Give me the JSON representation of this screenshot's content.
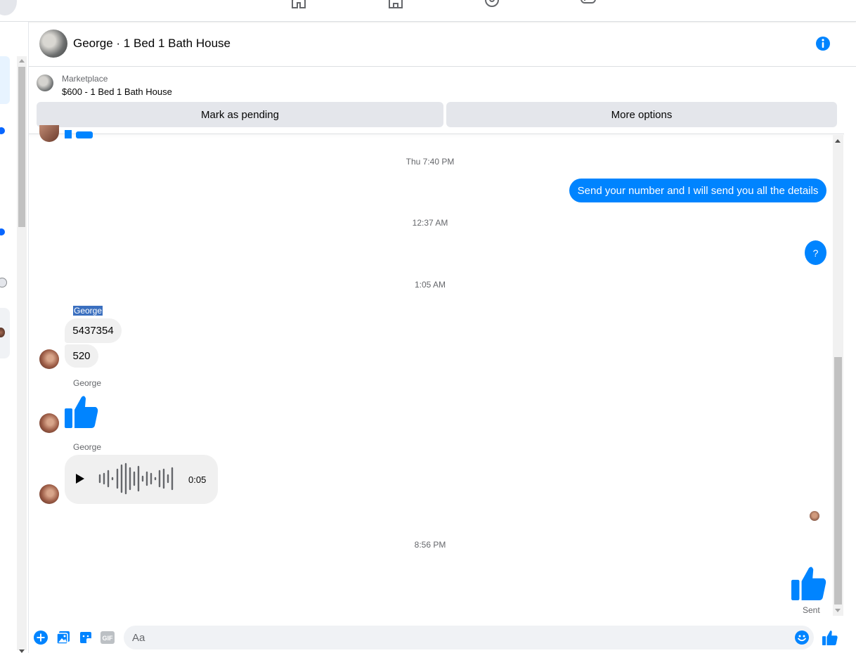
{
  "colors": {
    "accent": "#0084ff",
    "incoming_bubble": "#f0f0f0",
    "muted_text": "#65676b"
  },
  "header": {
    "title": "George · 1 Bed 1 Bath House"
  },
  "marketplace": {
    "label": "Marketplace",
    "listing": "$600 - 1 Bed 1 Bath House",
    "mark_pending_label": "Mark as pending",
    "more_options_label": "More options"
  },
  "messages": {
    "ts_1": "Thu 7:40 PM",
    "out_1": "Send your number and I will send you all the details",
    "ts_2": "12:37 AM",
    "out_2": "?",
    "ts_3": "1:05 AM",
    "sender_1": "George",
    "in_1": "5437354",
    "in_2": "520",
    "sender_2": "George",
    "sender_3": "George",
    "audio_duration": "0:05",
    "ts_4": "8:56 PM",
    "sent_status": "Sent"
  },
  "composer": {
    "placeholder": "Aa"
  },
  "icons": {
    "top_nav": [
      "home-icon",
      "marketplace-icon",
      "groups-icon",
      "gaming-icon"
    ],
    "composer": [
      "plus-icon",
      "photo-icon",
      "sticker-icon",
      "gif-icon",
      "emoji-icon",
      "like-icon"
    ]
  }
}
